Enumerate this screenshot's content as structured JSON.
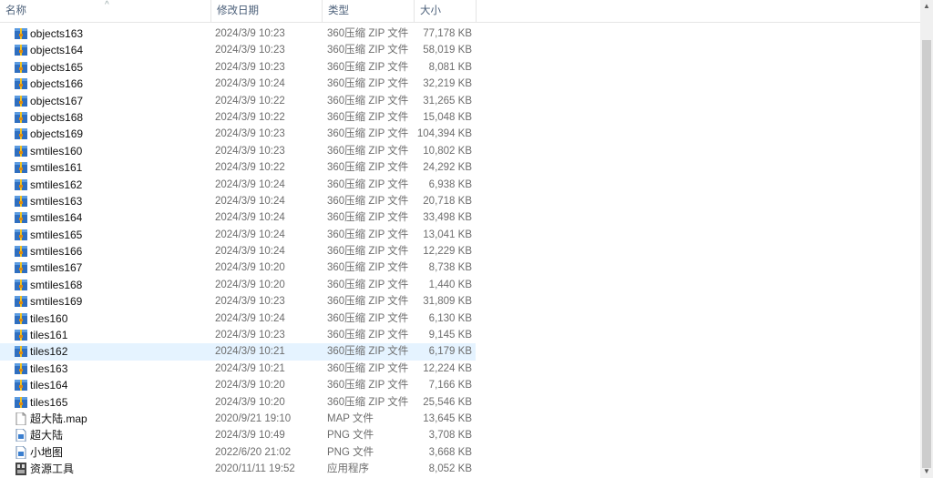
{
  "columns": {
    "name": "名称",
    "date": "修改日期",
    "type": "类型",
    "size": "大小"
  },
  "files": [
    {
      "name": "objects163",
      "date": "2024/3/9 10:23",
      "type": "360压缩 ZIP 文件",
      "size": "77,178 KB",
      "icon": "zip"
    },
    {
      "name": "objects164",
      "date": "2024/3/9 10:23",
      "type": "360压缩 ZIP 文件",
      "size": "58,019 KB",
      "icon": "zip"
    },
    {
      "name": "objects165",
      "date": "2024/3/9 10:23",
      "type": "360压缩 ZIP 文件",
      "size": "8,081 KB",
      "icon": "zip"
    },
    {
      "name": "objects166",
      "date": "2024/3/9 10:24",
      "type": "360压缩 ZIP 文件",
      "size": "32,219 KB",
      "icon": "zip"
    },
    {
      "name": "objects167",
      "date": "2024/3/9 10:22",
      "type": "360压缩 ZIP 文件",
      "size": "31,265 KB",
      "icon": "zip"
    },
    {
      "name": "objects168",
      "date": "2024/3/9 10:22",
      "type": "360压缩 ZIP 文件",
      "size": "15,048 KB",
      "icon": "zip"
    },
    {
      "name": "objects169",
      "date": "2024/3/9 10:23",
      "type": "360压缩 ZIP 文件",
      "size": "104,394 KB",
      "icon": "zip"
    },
    {
      "name": "smtiles160",
      "date": "2024/3/9 10:23",
      "type": "360压缩 ZIP 文件",
      "size": "10,802 KB",
      "icon": "zip"
    },
    {
      "name": "smtiles161",
      "date": "2024/3/9 10:22",
      "type": "360压缩 ZIP 文件",
      "size": "24,292 KB",
      "icon": "zip"
    },
    {
      "name": "smtiles162",
      "date": "2024/3/9 10:24",
      "type": "360压缩 ZIP 文件",
      "size": "6,938 KB",
      "icon": "zip"
    },
    {
      "name": "smtiles163",
      "date": "2024/3/9 10:24",
      "type": "360压缩 ZIP 文件",
      "size": "20,718 KB",
      "icon": "zip"
    },
    {
      "name": "smtiles164",
      "date": "2024/3/9 10:24",
      "type": "360压缩 ZIP 文件",
      "size": "33,498 KB",
      "icon": "zip"
    },
    {
      "name": "smtiles165",
      "date": "2024/3/9 10:24",
      "type": "360压缩 ZIP 文件",
      "size": "13,041 KB",
      "icon": "zip"
    },
    {
      "name": "smtiles166",
      "date": "2024/3/9 10:24",
      "type": "360压缩 ZIP 文件",
      "size": "12,229 KB",
      "icon": "zip"
    },
    {
      "name": "smtiles167",
      "date": "2024/3/9 10:20",
      "type": "360压缩 ZIP 文件",
      "size": "8,738 KB",
      "icon": "zip"
    },
    {
      "name": "smtiles168",
      "date": "2024/3/9 10:20",
      "type": "360压缩 ZIP 文件",
      "size": "1,440 KB",
      "icon": "zip"
    },
    {
      "name": "smtiles169",
      "date": "2024/3/9 10:23",
      "type": "360压缩 ZIP 文件",
      "size": "31,809 KB",
      "icon": "zip"
    },
    {
      "name": "tiles160",
      "date": "2024/3/9 10:24",
      "type": "360压缩 ZIP 文件",
      "size": "6,130 KB",
      "icon": "zip"
    },
    {
      "name": "tiles161",
      "date": "2024/3/9 10:23",
      "type": "360压缩 ZIP 文件",
      "size": "9,145 KB",
      "icon": "zip"
    },
    {
      "name": "tiles162",
      "date": "2024/3/9 10:21",
      "type": "360压缩 ZIP 文件",
      "size": "6,179 KB",
      "icon": "zip",
      "selected": true
    },
    {
      "name": "tiles163",
      "date": "2024/3/9 10:21",
      "type": "360压缩 ZIP 文件",
      "size": "12,224 KB",
      "icon": "zip"
    },
    {
      "name": "tiles164",
      "date": "2024/3/9 10:20",
      "type": "360压缩 ZIP 文件",
      "size": "7,166 KB",
      "icon": "zip"
    },
    {
      "name": "tiles165",
      "date": "2024/3/9 10:20",
      "type": "360压缩 ZIP 文件",
      "size": "25,546 KB",
      "icon": "zip"
    },
    {
      "name": "超大陆.map",
      "date": "2020/9/21 19:10",
      "type": "MAP 文件",
      "size": "13,645 KB",
      "icon": "doc"
    },
    {
      "name": "超大陆",
      "date": "2024/3/9 10:49",
      "type": "PNG 文件",
      "size": "3,708 KB",
      "icon": "png"
    },
    {
      "name": "小地图",
      "date": "2022/6/20 21:02",
      "type": "PNG 文件",
      "size": "3,668 KB",
      "icon": "png"
    },
    {
      "name": "资源工具",
      "date": "2020/11/11 19:52",
      "type": "应用程序",
      "size": "8,052 KB",
      "icon": "exe"
    }
  ]
}
